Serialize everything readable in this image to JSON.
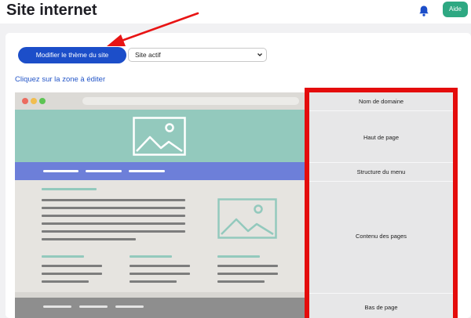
{
  "header": {
    "title": "Site internet",
    "help_label": "Aide",
    "bell_icon": "bell-icon"
  },
  "toolbar": {
    "theme_button_label": "Modifier le thème du site",
    "site_select_value": "Site actif"
  },
  "instruction": "Cliquez sur la zone à éditer",
  "zones": {
    "domain": "Nom de domaine",
    "header": "Haut de page",
    "menu": "Structure du menu",
    "content": "Contenu des pages",
    "footer": "Bas de page"
  },
  "colors": {
    "primary": "#1c4ec9",
    "help": "#2ea882",
    "highlight": "#e40c0c",
    "mock_header": "#93c9bd",
    "mock_nav": "#6d7fd9"
  }
}
